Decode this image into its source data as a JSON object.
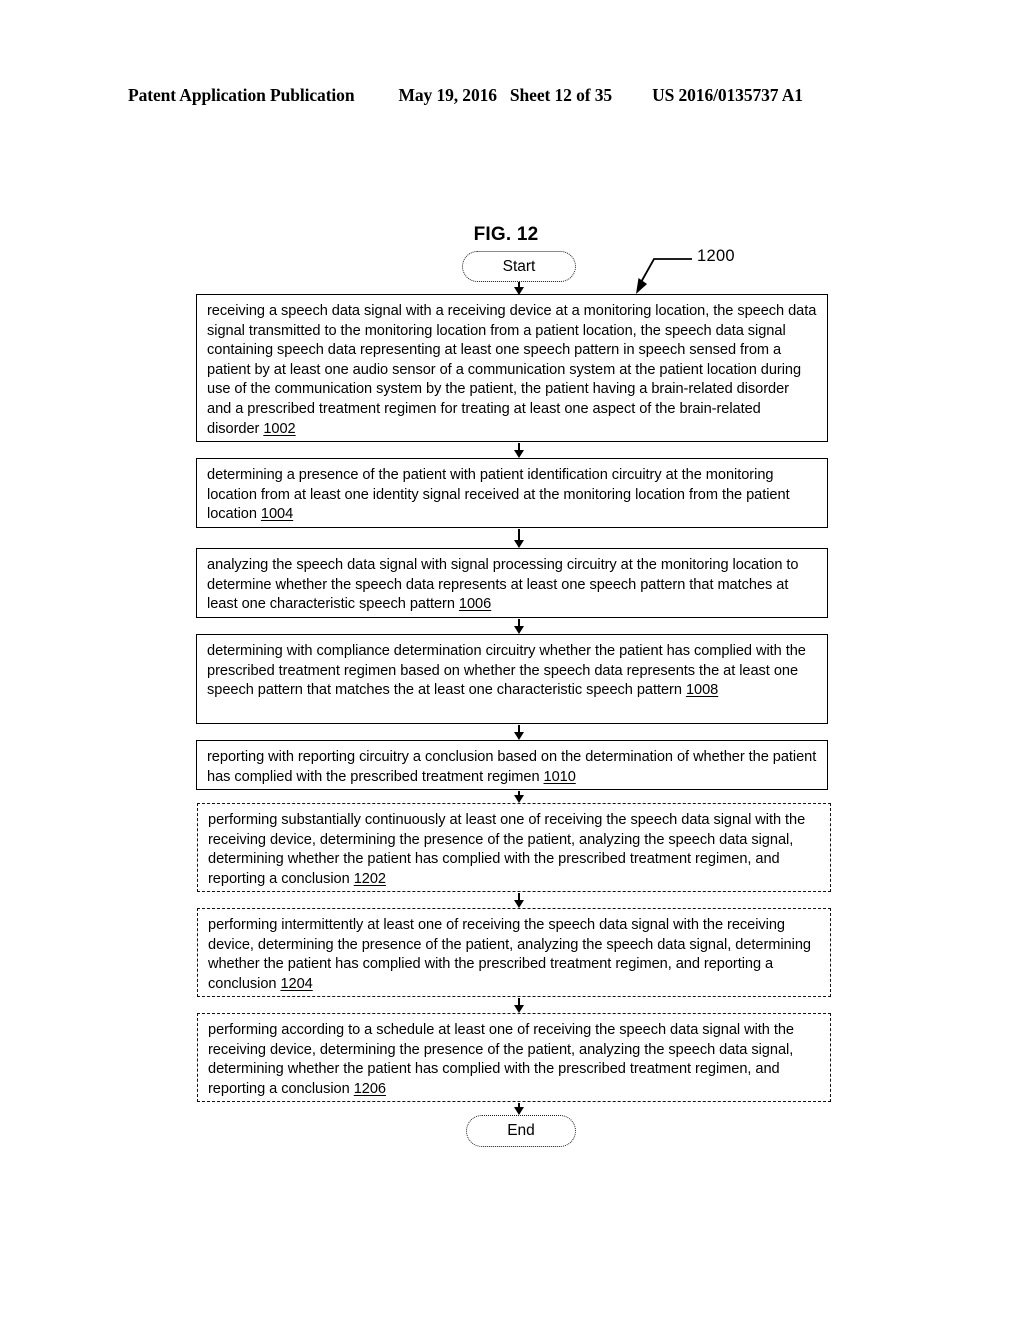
{
  "header": {
    "publication": "Patent Application Publication",
    "date": "May 19, 2016",
    "sheet": "Sheet 12 of 35",
    "patent_number": "US 2016/0135737 A1"
  },
  "figure": {
    "title": "FIG. 12",
    "figure_reference": "1200",
    "start_label": "Start",
    "end_label": "End",
    "steps": [
      {
        "id": "1002",
        "style": "solid",
        "text": "receiving a speech data signal with a receiving device at a monitoring location, the speech data signal transmitted to the monitoring location from a patient location, the speech data signal containing speech data representing at least one speech pattern in speech sensed from a patient by at least one audio sensor of a communication system at the patient location during use of the communication system by the patient, the patient having a brain-related disorder and a prescribed treatment regimen for treating at least one aspect of the brain-related disorder"
      },
      {
        "id": "1004",
        "style": "solid",
        "text": "determining a presence of the patient with patient identification circuitry at the monitoring location from at least one identity signal received at the monitoring location from the patient location"
      },
      {
        "id": "1006",
        "style": "solid",
        "text": "analyzing the speech data signal with signal processing circuitry at the monitoring location to determine whether the speech data represents at least one speech pattern that matches at least one characteristic speech pattern"
      },
      {
        "id": "1008",
        "style": "solid",
        "text": "determining with compliance determination circuitry whether the patient has complied with the prescribed treatment regimen based on whether the speech data represents the at least one speech pattern that matches the at least one characteristic speech pattern"
      },
      {
        "id": "1010",
        "style": "solid",
        "text": "reporting with reporting circuitry a conclusion based on the determination of whether the patient has complied with the prescribed treatment regimen"
      },
      {
        "id": "1202",
        "style": "dashed",
        "text": "performing substantially continuously at least one of receiving the speech data signal with the receiving device, determining the presence of the patient, analyzing the speech data signal, determining whether the patient has complied with the prescribed treatment regimen, and reporting a conclusion"
      },
      {
        "id": "1204",
        "style": "dashed",
        "text": "performing intermittently at least one of receiving the speech data signal with the receiving device, determining the presence of the patient, analyzing the speech data signal, determining whether the patient has complied with the prescribed treatment regimen, and reporting a conclusion"
      },
      {
        "id": "1206",
        "style": "dashed",
        "text": "performing according to a schedule at least one of receiving the speech data signal with the receiving device, determining the presence of the patient, analyzing the speech data signal, determining whether the patient has complied with the prescribed treatment regimen, and reporting a conclusion"
      }
    ]
  }
}
